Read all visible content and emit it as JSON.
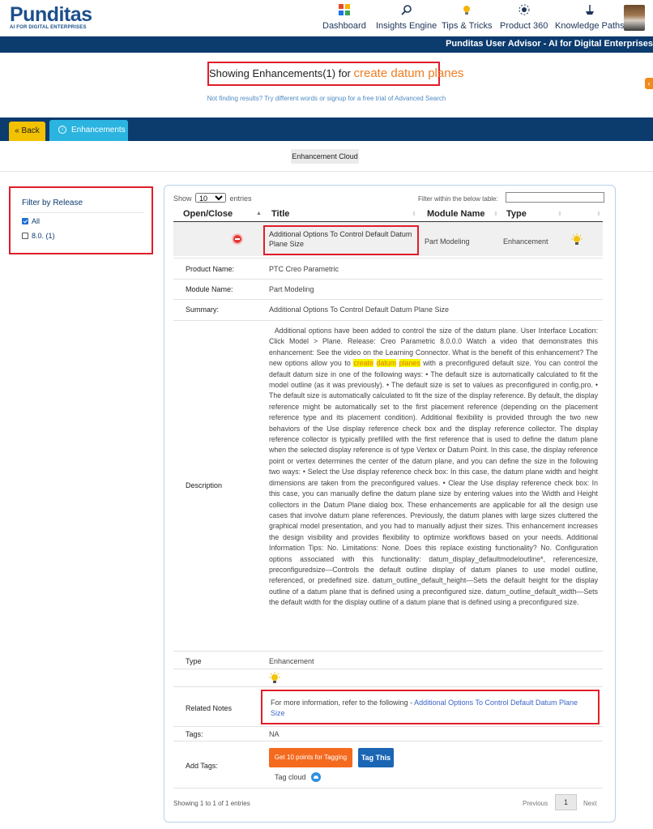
{
  "header": {
    "logo_text": "Punditas",
    "logo_tagline": "AI FOR DIGITAL ENTERPRISES",
    "nav": [
      {
        "label": "Dashboard",
        "icon": "dashboard-icon"
      },
      {
        "label": "Insights Engine",
        "icon": "search-insights-icon"
      },
      {
        "label": "Tips & Tricks",
        "icon": "lightbulb-icon"
      },
      {
        "label": "Product 360",
        "icon": "product-360-icon"
      },
      {
        "label": "Knowledge Paths",
        "icon": "knowledge-paths-icon"
      }
    ],
    "advisor_title": "Punditas User Advisor - AI for Digital Enterprises"
  },
  "search": {
    "showing_prefix": "Showing Enhancements(1) for",
    "query": "create datum planes",
    "hint": "Not finding results? Try different words or signup for a free trial of Advanced Search"
  },
  "tabs": {
    "back_label": "« Back",
    "enhancements_label": "Enhancements",
    "cloud_button": "Enhancement Cloud"
  },
  "filter": {
    "title": "Filter by Release",
    "options": [
      {
        "label": "All",
        "checked": true
      },
      {
        "label": "8.0. (1)",
        "checked": false
      }
    ]
  },
  "table": {
    "show_prefix": "Show",
    "show_value": "10",
    "show_suffix": "entries",
    "filter_label": "Filter within the below table:",
    "columns": [
      "Open/Close",
      "Title",
      "Module Name",
      "Type"
    ],
    "row": {
      "title": "Additional Options To Control Default Datum Plane Size",
      "module": "Part Modeling",
      "type": "Enhancement"
    },
    "details": {
      "product_label": "Product Name:",
      "product_value": "PTC Creo Parametric",
      "module_label": "Module Name:",
      "module_value": "Part Modeling",
      "summary_label": "Summary:",
      "summary_value": "Additional Options To Control Default Datum Plane Size",
      "description_label": "Description",
      "description_before": "Additional options have been added to control the size of the datum plane. User Interface Location: Click Model > Plane. Release: Creo Parametric 8.0.0.0 Watch a video that demonstrates this enhancement: See the video on the Learning Connector. What is the benefit of this enhancement? The new options allow you to",
      "hl1": "create",
      "hl2": "datum",
      "hl3": "planes",
      "description_after": "with a preconfigured default size. You can control the default datum size in one of the following ways: • The default size is automatically calculated to fit the model outline (as it was previously). • The default size is set to values as preconfigured in config.pro. • The default size is automatically calculated to fit the size of the display reference. By default, the display reference might be automatically set to the first placement reference (depending on the placement reference type and its placement condition). Additional flexibility is provided through the two new behaviors of the Use display reference check box and the display reference collector. The display reference collector is typically prefilled with the first reference that is used to define the datum plane when the selected display reference is of type Vertex or Datum Point. In this case, the display reference point or vertex determines the center of the datum plane, and you can define the size in the following two ways: • Select the Use display reference check box: In this case, the datum plane width and height dimensions are taken from the preconfigured values. • Clear the Use display reference check box: In this case, you can manually define the datum plane size by entering values into the Width and Height collectors in the Datum Plane dialog box. These enhancements are applicable for all the design use cases that involve datum plane references. Previously, the datum planes with large sizes cluttered the graphical model presentation, and you had to manually adjust their sizes. This enhancement increases the design visibility and provides flexibility to optimize workflows based on your needs. Additional Information Tips: No. Limitations: None. Does this replace existing functionality? No. Configuration options associated with this functionality: datum_display_defaultmodeloutline*, referencesize, preconfiguredsize—Controls the default outline display of datum planes to use model outline, referenced, or predefined size. datum_outline_default_height—Sets the default height for the display outline of a datum plane that is defined using a preconfigured size. datum_outline_default_width—Sets the default width for the display outline of a datum plane that is defined using a preconfigured size.",
      "type_label": "Type",
      "type_value": "Enhancement",
      "related_label": "Related Notes",
      "related_prefix": "For more information, refer to the following -",
      "related_link": "Additional Options To Control Default Datum Plane Size",
      "tags_label": "Tags:",
      "tags_value": "NA",
      "addtags_label": "Add Tags:",
      "points_button": "Get 10 points for Tagging",
      "tag_button": "Tag This",
      "tagcloud_label": "Tag cloud"
    },
    "footer": {
      "info": "Showing 1 to 1 of 1 entries",
      "previous": "Previous",
      "page": "1",
      "next": "Next"
    }
  },
  "colors": {
    "brand_navy": "#0c3b6e",
    "highlight_orange": "#f07c20",
    "annotation_red": "#e11d2a"
  }
}
